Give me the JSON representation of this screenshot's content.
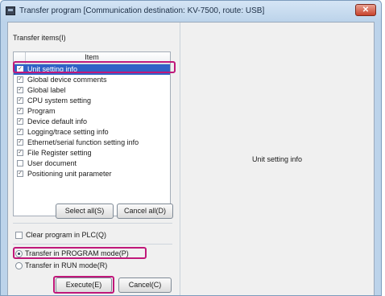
{
  "window": {
    "title": "Transfer program [Communication destination: KV-7500, route: USB]",
    "close_glyph": "✕"
  },
  "transfer_items": {
    "label": "Transfer items(I)",
    "column_header": "Item",
    "items": [
      {
        "label": "Unit setting info",
        "checked": true,
        "selected": true
      },
      {
        "label": "Global device comments",
        "checked": true,
        "selected": false
      },
      {
        "label": "Global label",
        "checked": true,
        "selected": false
      },
      {
        "label": "CPU system setting",
        "checked": true,
        "selected": false
      },
      {
        "label": "Program",
        "checked": true,
        "selected": false
      },
      {
        "label": "Device default info",
        "checked": true,
        "selected": false
      },
      {
        "label": "Logging/trace setting info",
        "checked": true,
        "selected": false
      },
      {
        "label": "Ethernet/serial function setting info",
        "checked": true,
        "selected": false
      },
      {
        "label": "File Register setting",
        "checked": true,
        "selected": false
      },
      {
        "label": "User document",
        "checked": false,
        "selected": false
      },
      {
        "label": "Positioning unit parameter",
        "checked": true,
        "selected": false
      }
    ]
  },
  "buttons": {
    "select_all": "Select all(S)",
    "cancel_all": "Cancel all(D)",
    "execute": "Execute(E)",
    "cancel": "Cancel(C)"
  },
  "options": {
    "clear_program": {
      "label": "Clear program in PLC(Q)",
      "checked": false
    },
    "modes": [
      {
        "label": "Transfer in PROGRAM mode(P)",
        "selected": true
      },
      {
        "label": "Transfer in RUN mode(R)",
        "selected": false
      }
    ]
  },
  "detail": {
    "text": "Unit setting info"
  },
  "colors": {
    "highlight": "#c0187a",
    "selection": "#2f62c7"
  }
}
